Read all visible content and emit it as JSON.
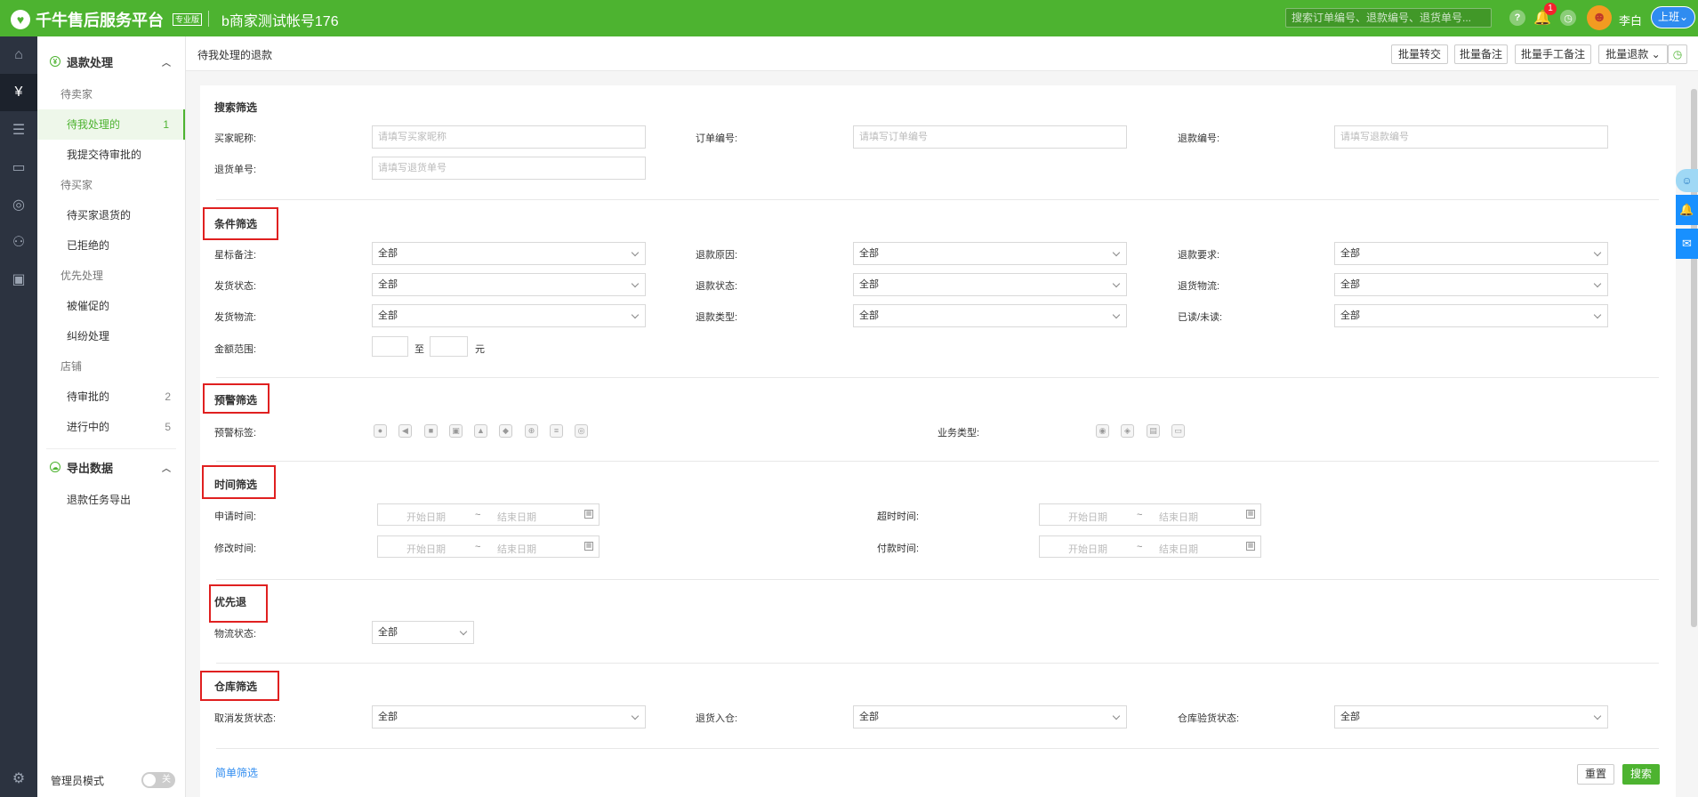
{
  "app": {
    "title": "千牛售后服务平台",
    "badge": "专业版",
    "account": "b商家测试帐号176",
    "search_placeholder": "搜索订单编号、退款编号、退货单号...",
    "notification_count": "1",
    "username": "李白",
    "shift_label": "上班",
    "brand_color": "#4db330",
    "accent_color": "#1890ff"
  },
  "sidebar": {
    "section1": "退款处理",
    "groups": [
      {
        "label": "待卖家",
        "items": [
          {
            "label": "待我处理的",
            "count": "1"
          },
          {
            "label": "我提交待审批的"
          }
        ]
      },
      {
        "label": "待买家",
        "items": [
          {
            "label": "待买家退货的"
          },
          {
            "label": "已拒绝的"
          }
        ]
      },
      {
        "label": "优先处理",
        "items": [
          {
            "label": "被催促的"
          },
          {
            "label": "纠纷处理"
          }
        ]
      },
      {
        "label": "店铺",
        "items": [
          {
            "label": "待审批的",
            "count": "2"
          },
          {
            "label": "进行中的",
            "count": "5"
          }
        ]
      }
    ],
    "section2": "导出数据",
    "export_item": "退款任务导出",
    "admin_mode": "管理员模式",
    "toggle_label": "关"
  },
  "page": {
    "title": "待我处理的退款",
    "buttons": {
      "transfer": "批量转交",
      "remark": "批量备注",
      "manual_remark": "批量手工备注",
      "refund": "批量退款"
    }
  },
  "filters": {
    "search": {
      "title": "搜索筛选",
      "buyer_nick": {
        "label": "买家昵称:",
        "placeholder": "请填写买家昵称"
      },
      "order_no": {
        "label": "订单编号:",
        "placeholder": "请填写订单编号"
      },
      "refund_no": {
        "label": "退款编号:",
        "placeholder": "请填写退款编号"
      },
      "return_no": {
        "label": "退货单号:",
        "placeholder": "请填写退货单号"
      }
    },
    "condition": {
      "title": "条件筛选",
      "star_remark": {
        "label": "星标备注:",
        "value": "全部"
      },
      "refund_reason": {
        "label": "退款原因:",
        "value": "全部"
      },
      "refund_request": {
        "label": "退款要求:",
        "value": "全部"
      },
      "ship_status": {
        "label": "发货状态:",
        "value": "全部"
      },
      "refund_status": {
        "label": "退款状态:",
        "value": "全部"
      },
      "return_logistics": {
        "label": "退货物流:",
        "value": "全部"
      },
      "ship_logistics": {
        "label": "发货物流:",
        "value": "全部"
      },
      "refund_type": {
        "label": "退款类型:",
        "value": "全部"
      },
      "read_status": {
        "label": "已读/未读:",
        "value": "全部"
      },
      "amount": {
        "label": "金额范围:",
        "to": "至",
        "unit": "元"
      }
    },
    "warning": {
      "title": "预警筛选",
      "tag_label": "预警标签:",
      "tags": [
        "●",
        "◀",
        "■",
        "▣",
        "▲",
        "◆",
        "⊕",
        "≡",
        "◎"
      ],
      "biz_label": "业务类型:",
      "biz_tags": [
        "◉",
        "◈",
        "▤",
        "▭"
      ]
    },
    "time": {
      "title": "时间筛选",
      "apply": {
        "label": "申请时间:"
      },
      "timeout": {
        "label": "超时时间:"
      },
      "modify": {
        "label": "修改时间:"
      },
      "pay": {
        "label": "付款时间:"
      },
      "start": "开始日期",
      "sep": "~",
      "end": "结束日期"
    },
    "priority": {
      "title": "优先退",
      "logistics": {
        "label": "物流状态:",
        "value": "全部"
      }
    },
    "warehouse": {
      "title": "仓库筛选",
      "cancel_ship": {
        "label": "取消发货状态:",
        "value": "全部"
      },
      "return_in": {
        "label": "退货入仓:",
        "value": "全部"
      },
      "inspect": {
        "label": "仓库验货状态:",
        "value": "全部"
      }
    }
  },
  "footer": {
    "simple_filter": "简单筛选",
    "reset": "重置",
    "search": "搜索"
  }
}
